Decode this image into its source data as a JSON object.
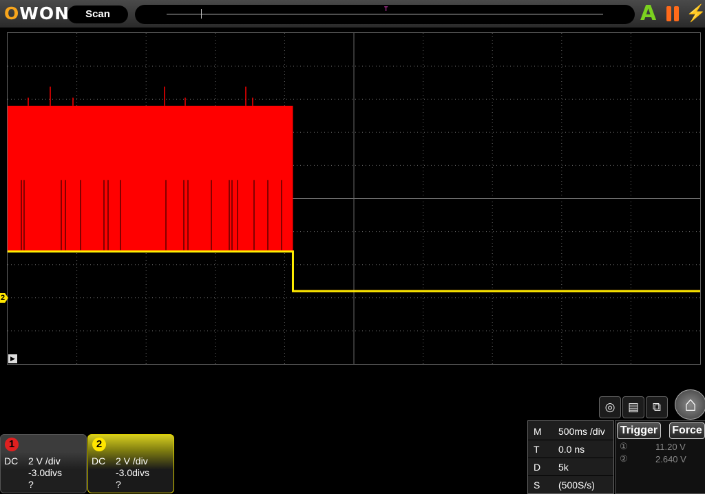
{
  "brand": {
    "logo_o": "O",
    "logo_rest": "WON"
  },
  "topbar": {
    "mode_label": "Scan",
    "trigger_status": "A",
    "trigger_marker": "T",
    "pause_icon": "pause-icon",
    "bolt_icon": "lightning-icon"
  },
  "colors": {
    "ch1": "#ff0000",
    "ch2": "#ffee00",
    "grid": "#6a6a6a",
    "logo_accent": "#f7a51c",
    "trigger_ok": "#7bd11f",
    "pause": "#ff6a1a"
  },
  "display": {
    "h_divisions": 10,
    "v_divisions": 10,
    "ch2_marker_label": "2",
    "run_marker_label": "▶"
  },
  "waveform": {
    "description": "channel 1 dense burst until ~4.1 div then flat; channel 2 steps low at ~4.1 div",
    "burst_end_div": 4.12,
    "ch1_top_div": 2.2,
    "ch1_bottom_div": 6.6,
    "ch2_high_div": 6.6,
    "ch2_low_div": 7.8
  },
  "channels": [
    {
      "id": "1",
      "coupling": "DC",
      "scale": "2 V /div",
      "offset": "-3.0divs",
      "probe": "?"
    },
    {
      "id": "2",
      "coupling": "DC",
      "scale": "2 V /div",
      "offset": "-3.0divs",
      "probe": "?"
    }
  ],
  "toolbar": {
    "buttons": [
      "screenshot-icon",
      "save-icon",
      "window-icon"
    ],
    "home_icon": "home-icon"
  },
  "timebase": {
    "rows": [
      {
        "label": "M",
        "value": "500ms /div"
      },
      {
        "label": "T",
        "value": "0.0 ns"
      },
      {
        "label": "D",
        "value": "5k"
      },
      {
        "label": "S",
        "value": "(500S/s)"
      }
    ]
  },
  "trigger": {
    "trigger_button": "Trigger",
    "force_button": "Force",
    "levels": [
      {
        "ch": "①",
        "value": "11.20 V"
      },
      {
        "ch": "②",
        "value": "2.640 V"
      }
    ]
  }
}
